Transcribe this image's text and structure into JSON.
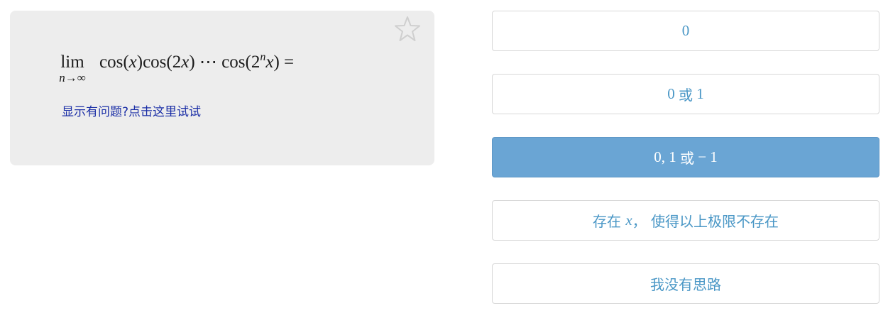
{
  "question": {
    "limit": {
      "operator": "lim",
      "subscript_var": "n",
      "subscript_arrow": "→∞"
    },
    "expression": {
      "part1": "cos(",
      "var1": "x",
      "part2": ")cos(2",
      "var2": "x",
      "part3": ") ⋯ cos(2",
      "exponent": "n",
      "var3": "x",
      "part4": ") ="
    },
    "help_link": "显示有问题?点击这里试试",
    "favorite_icon": "star-outline-icon"
  },
  "options": [
    {
      "label": "0",
      "selected": false
    },
    {
      "label_prefix": "0 ",
      "label_cjk": "或",
      "label_suffix": " 1",
      "selected": false
    },
    {
      "label_prefix": "0, 1 ",
      "label_cjk": "或",
      "label_suffix": " − 1",
      "selected": true
    },
    {
      "label_prefix_cjk": "存在 ",
      "label_var": "x",
      "label_suffix_cjk": "， 使得以上极限不存在",
      "selected": false
    },
    {
      "label_cjk": "我没有思路",
      "selected": false
    }
  ],
  "colors": {
    "card_bg": "#ededed",
    "option_text": "#4a97c6",
    "selected_bg": "#6aa5d4",
    "link": "#1a2ea6"
  }
}
